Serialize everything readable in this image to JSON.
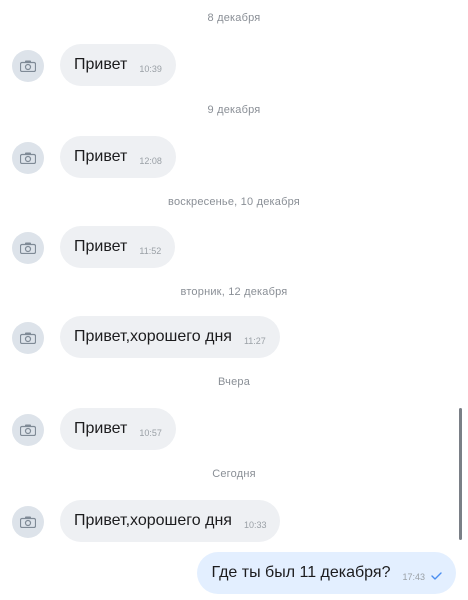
{
  "messages": [
    {
      "date": "8 декабря",
      "text": "Привет",
      "time": "10:39"
    },
    {
      "date": "9 декабря",
      "text": "Привет",
      "time": "12:08"
    },
    {
      "date": "воскресенье, 10 декабря",
      "text": "Привет",
      "time": "11:52"
    },
    {
      "date": "вторник, 12 декабря",
      "text": "Привет,хорошего дня",
      "time": "11:27"
    },
    {
      "date": "Вчера",
      "text": "Привет",
      "time": "10:57"
    },
    {
      "date": "Сегодня",
      "text": "Привет,хорошего дня",
      "time": "10:33"
    }
  ],
  "outgoing": {
    "text": "Где ты был 11 декабря?",
    "time": "17:43"
  },
  "colors": {
    "incoming_bubble": "#eef0f3",
    "outgoing_bubble": "#e3efff",
    "avatar_bg": "#dde3ea",
    "check": "#4a8ef0"
  },
  "icons": {
    "avatar": "camera-icon",
    "status": "check-icon"
  }
}
